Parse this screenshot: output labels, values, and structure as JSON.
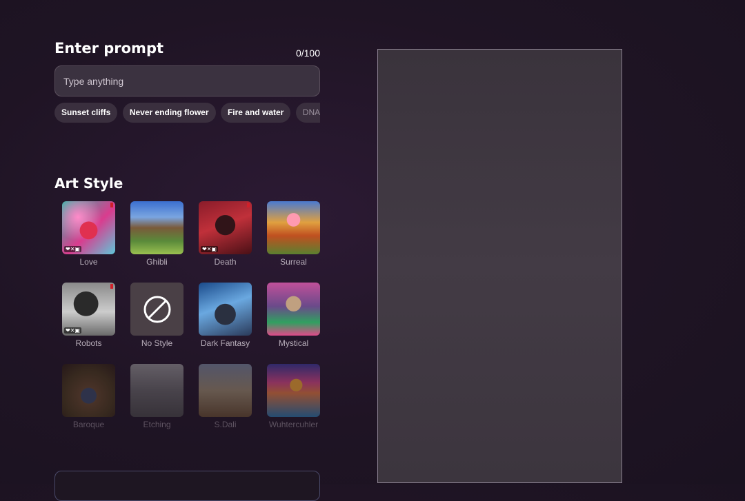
{
  "prompt": {
    "heading": "Enter prompt",
    "counter": "0/100",
    "placeholder": "Type anything",
    "value": "",
    "suggestions": [
      "Sunset cliffs",
      "Never ending flower",
      "Fire and water",
      "DNA tornado"
    ]
  },
  "art_style": {
    "heading": "Art Style",
    "styles": [
      {
        "label": "Love",
        "image": "love-artwork"
      },
      {
        "label": "Ghibli",
        "image": "ghibli-artwork"
      },
      {
        "label": "Death",
        "image": "death-artwork"
      },
      {
        "label": "Surreal",
        "image": "surreal-artwork"
      },
      {
        "label": "Robots",
        "image": "robots-artwork"
      },
      {
        "label": "No Style",
        "image": "no-style-icon"
      },
      {
        "label": "Dark Fantasy",
        "image": "dark-fantasy-artwork"
      },
      {
        "label": "Mystical",
        "image": "mystical-artwork"
      },
      {
        "label": "Baroque",
        "image": "baroque-artwork"
      },
      {
        "label": "Etching",
        "image": "etching-artwork"
      },
      {
        "label": "S.Dali",
        "image": "sdali-artwork"
      },
      {
        "label": "Wuhtercuhler",
        "image": "wuhtercuhler-artwork"
      }
    ]
  },
  "badge_text": "❤✕▣",
  "colors": {
    "background": "#1f1424",
    "input_bg": "#3b3240",
    "chip_bg": "#3a2f3e",
    "preview_bg": "#3f3841"
  }
}
